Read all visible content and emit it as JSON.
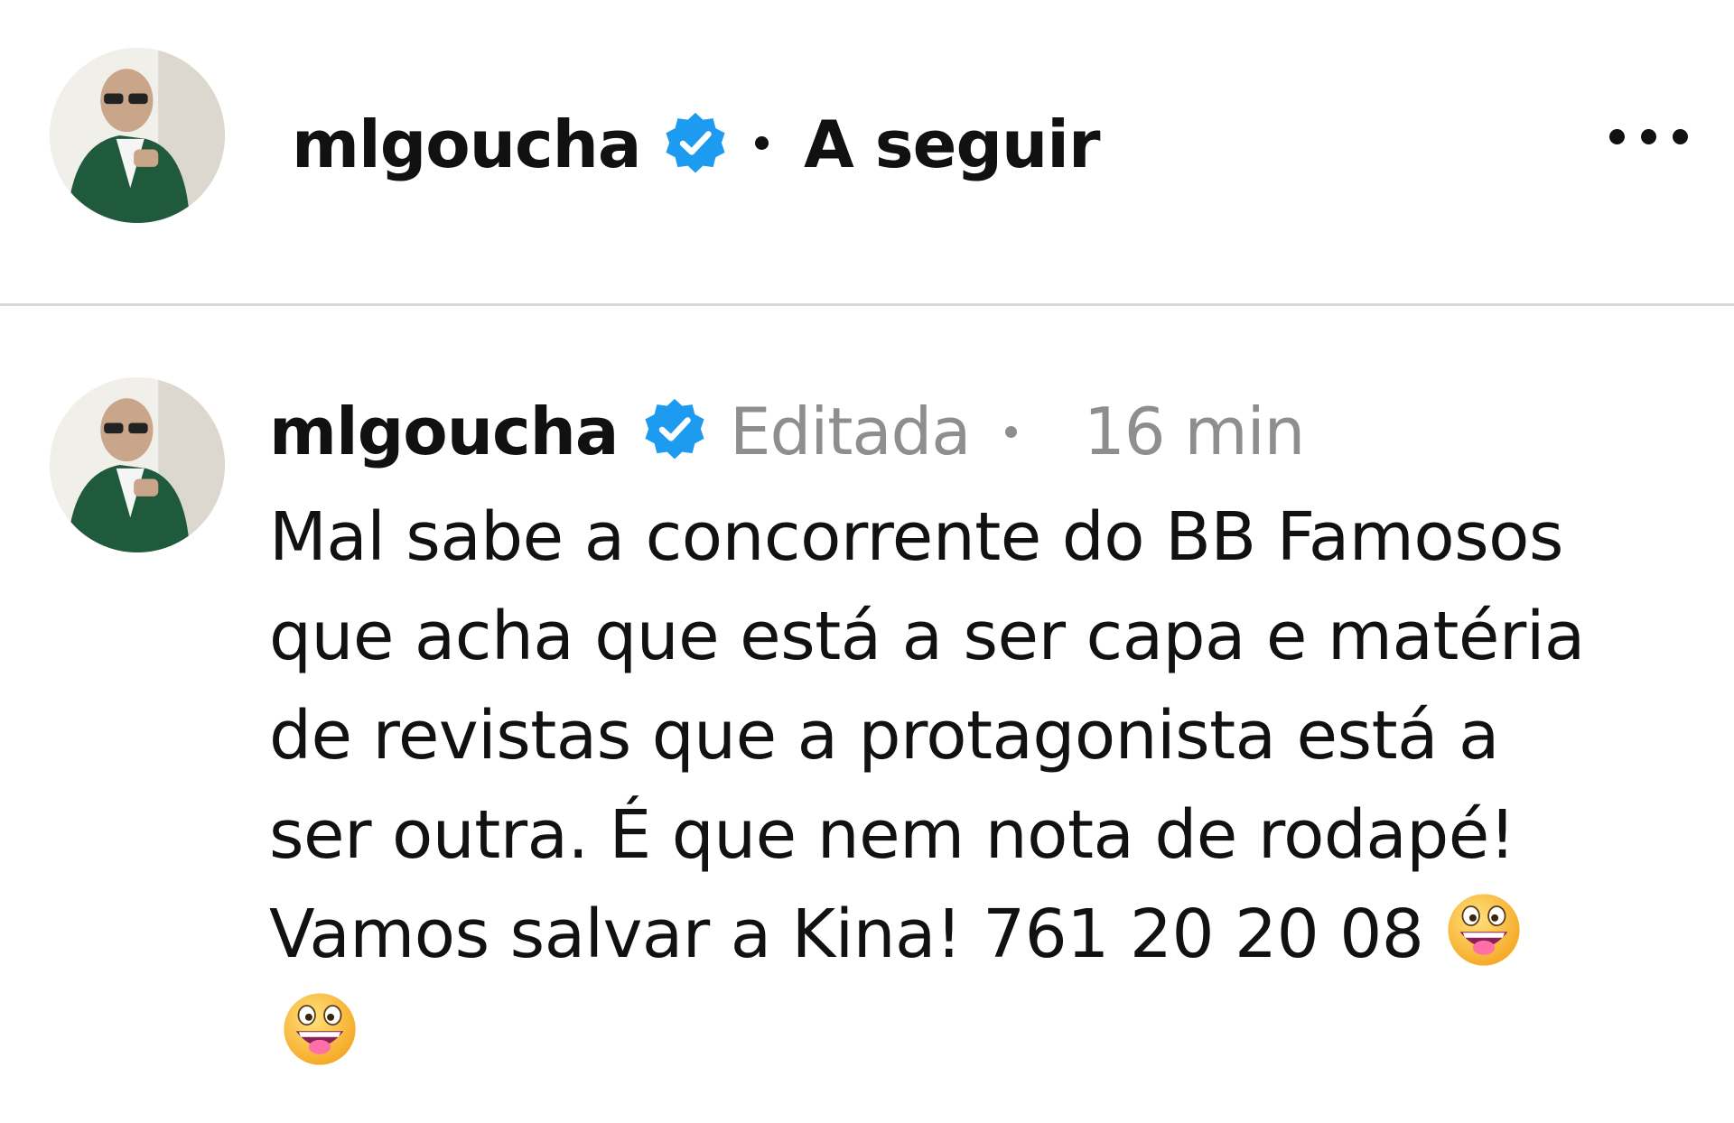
{
  "header": {
    "username": "mlgoucha",
    "separator": "•",
    "follow_label": "A seguir",
    "avatar_icon": "profile-photo",
    "verified_icon": "verified-badge-icon",
    "more_icon": "more-options-icon"
  },
  "comment": {
    "username": "mlgoucha",
    "edited_label": "Editada",
    "timestamp": "16 min",
    "lines": [
      "Mal sabe a concorrente do BB Famosos",
      "que acha que está a ser capa e matéria",
      "de revistas que a protagonista está a",
      "ser outra. É que nem nota de rodapé!",
      "Vamos salvar a Kina! 761 20 20 08"
    ],
    "emoji_icon": "grinning-face-with-tongue-emoji"
  },
  "colors": {
    "verified_blue": "#1d9bf0",
    "text": "#111111",
    "muted_text": "#8e8e8e",
    "divider": "#d9d9d9",
    "avatar_jacket": "#1f5a3c"
  }
}
